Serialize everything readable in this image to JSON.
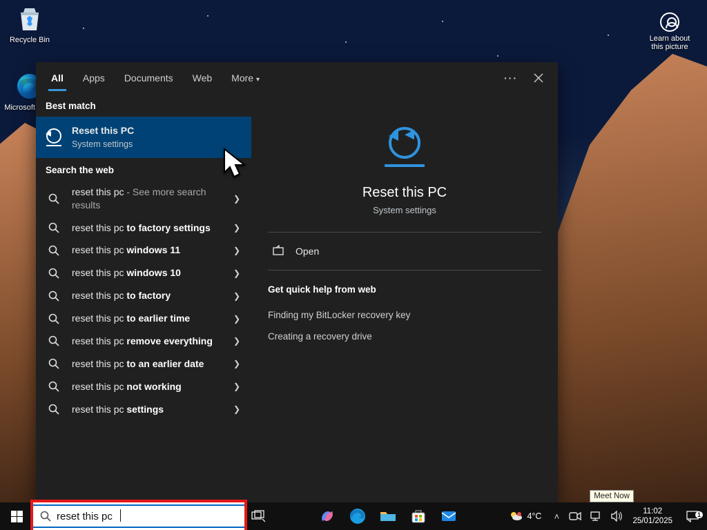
{
  "desktop": {
    "icons": [
      {
        "name": "recycle-bin",
        "label": "Recycle Bin"
      },
      {
        "name": "microsoft-edge",
        "label": "Microsoft Edge"
      }
    ],
    "learn_about": {
      "line1": "Learn about",
      "line2": "this picture"
    }
  },
  "search_panel": {
    "tabs": [
      "All",
      "Apps",
      "Documents",
      "Web",
      "More"
    ],
    "active_tab": 0,
    "sections": {
      "best_match": "Best match",
      "search_web": "Search the web"
    },
    "best_match": {
      "title": "Reset this PC",
      "subtitle": "System settings"
    },
    "web_results": [
      {
        "prefix": "reset this pc",
        "suffix": "",
        "extra": " - See more search results"
      },
      {
        "prefix": "reset this pc ",
        "suffix": "to factory settings",
        "extra": ""
      },
      {
        "prefix": "reset this pc ",
        "suffix": "windows 11",
        "extra": ""
      },
      {
        "prefix": "reset this pc ",
        "suffix": "windows 10",
        "extra": ""
      },
      {
        "prefix": "reset this pc ",
        "suffix": "to factory",
        "extra": ""
      },
      {
        "prefix": "reset this pc ",
        "suffix": "to earlier time",
        "extra": ""
      },
      {
        "prefix": "reset this pc ",
        "suffix": "remove everything",
        "extra": ""
      },
      {
        "prefix": "reset this pc ",
        "suffix": "to an earlier date",
        "extra": ""
      },
      {
        "prefix": "reset this pc ",
        "suffix": "not working",
        "extra": ""
      },
      {
        "prefix": "reset this pc ",
        "suffix": "settings",
        "extra": ""
      }
    ],
    "preview": {
      "title": "Reset this PC",
      "subtitle": "System settings",
      "open_label": "Open",
      "quick_help_heading": "Get quick help from web",
      "quick_help_links": [
        "Finding my BitLocker recovery key",
        "Creating a recovery drive"
      ]
    }
  },
  "taskbar": {
    "search_value": "reset this pc",
    "weather": {
      "temp": "4°C"
    },
    "meet_tooltip": "Meet Now",
    "time": "11:02",
    "date": "25/01/2025",
    "notif_count": "1"
  }
}
